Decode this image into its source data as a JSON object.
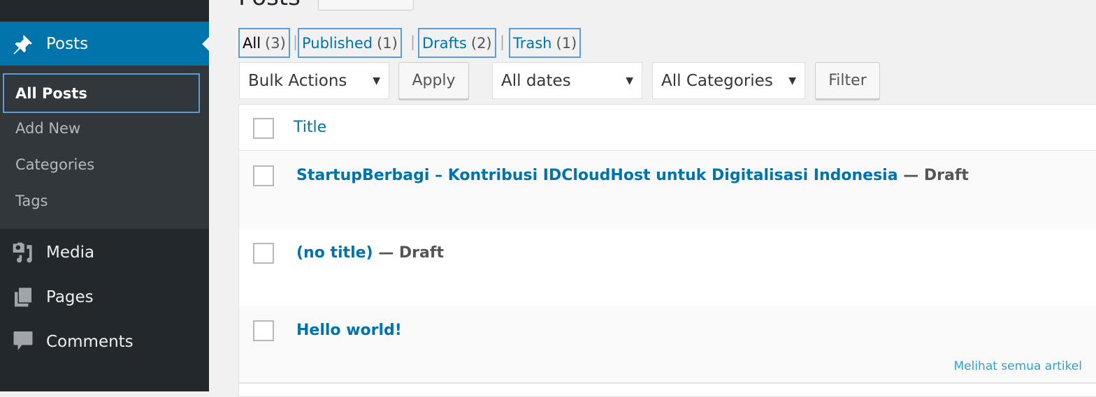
{
  "sidebar": {
    "posts": {
      "label": "Posts",
      "icon": "pin-icon"
    },
    "submenu": [
      "All Posts",
      "Add New",
      "Categories",
      "Tags"
    ],
    "items": [
      {
        "label": "Media",
        "icon": "media-icon"
      },
      {
        "label": "Pages",
        "icon": "pages-icon"
      },
      {
        "label": "Comments",
        "icon": "comments-icon"
      }
    ]
  },
  "header": {
    "title": "Posts"
  },
  "filters": [
    {
      "label": "All",
      "count": "(3)"
    },
    {
      "label": "Published",
      "count": "(1)"
    },
    {
      "label": "Drafts",
      "count": "(2)"
    },
    {
      "label": "Trash",
      "count": "(1)"
    }
  ],
  "toolbar": {
    "bulk": "Bulk Actions",
    "apply": "Apply",
    "dates": "All dates",
    "categories": "All Categories",
    "filter": "Filter"
  },
  "table": {
    "header": "Title",
    "rows": [
      {
        "title": "StartupBerbagi – Kontribusi IDCloudHost untuk Digitalisasi Indonesia",
        "state": " — Draft"
      },
      {
        "title": "(no title)",
        "state": " — Draft"
      },
      {
        "title": "Hello world!",
        "state": ""
      }
    ]
  },
  "footer_link": "Melihat semua artikel",
  "colors": {
    "sidebar": "#23282d",
    "active": "#0073aa",
    "link": "#0073aa"
  }
}
